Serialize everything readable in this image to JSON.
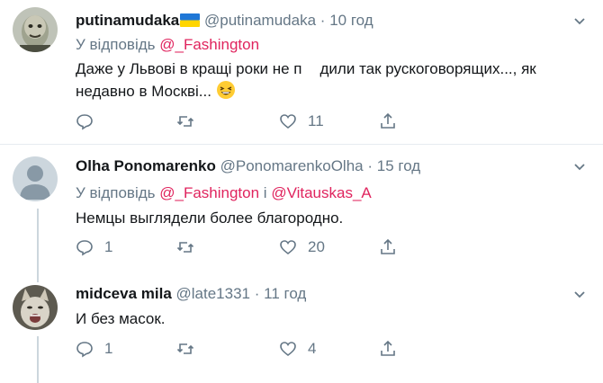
{
  "tweets": [
    {
      "name": "putinamudaka",
      "has_flag": true,
      "handle": "@putinamudaka",
      "dot": "·",
      "time": "10 год",
      "reply_prefix": "У відповідь",
      "reply_to": "@_Fashington",
      "text_line1": "Даже у Львові в кращі роки не п",
      "text_line1b": "дили так рускоговорящих..., як",
      "text_line2": "недавно в Москві...",
      "reply_count": "",
      "retweet_count": "",
      "like_count": "11"
    },
    {
      "name": "Olha Ponomarenko",
      "handle": "@PonomarenkoOlha",
      "dot": "·",
      "time": "15 год",
      "reply_prefix": "У відповідь",
      "reply_to": "@_Fashington",
      "reply_joiner": "і",
      "reply_to2": "@Vitauskas_A",
      "text_line1": "Немцы выглядели более благородно.",
      "reply_count": "1",
      "retweet_count": "",
      "like_count": "20"
    },
    {
      "name": "midceva mila",
      "handle": "@late1331",
      "dot": "·",
      "time": "11 год",
      "text_line1": "И без масок.",
      "reply_count": "1",
      "retweet_count": "",
      "like_count": "4"
    }
  ],
  "icons": {
    "reply": "reply-icon",
    "retweet": "retweet-icon",
    "like": "heart-icon",
    "share": "share-icon",
    "caret": "chevron-down-icon"
  },
  "colors": {
    "mention": "#e0245e",
    "secondary": "#657786",
    "divider": "#e6ecf0"
  }
}
